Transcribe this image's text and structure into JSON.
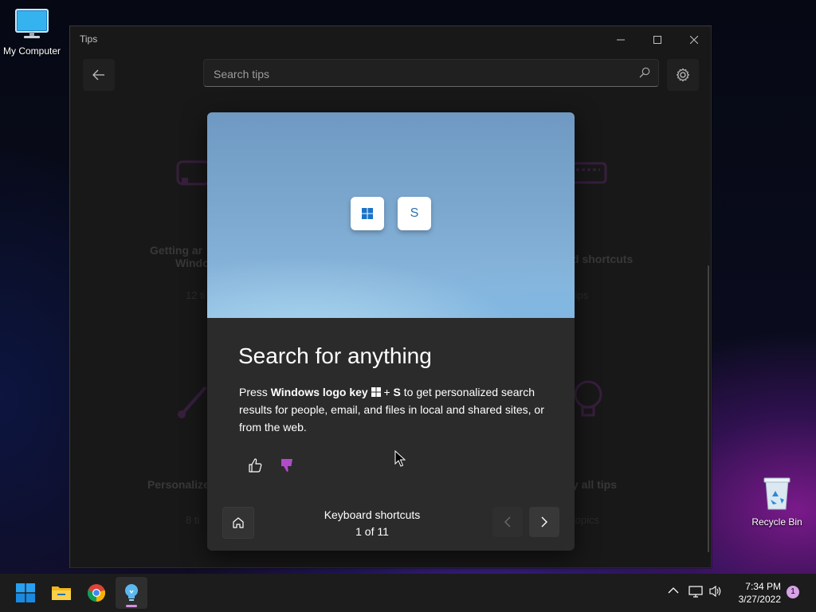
{
  "desktop": {
    "icons": [
      {
        "label": "My Computer"
      },
      {
        "label": "Recycle Bin"
      }
    ]
  },
  "window": {
    "title": "Tips",
    "search_placeholder": "Search tips"
  },
  "background_cards": [
    {
      "label": "Getting ar",
      "label2": "Windo",
      "sub": "12 ti"
    },
    {
      "label": "d shortcuts",
      "sub": "tips"
    },
    {
      "label": "Personalize",
      "sub": "8 ti"
    },
    {
      "label": "y all tips",
      "sub": "topics"
    }
  ],
  "dialog": {
    "title": "Search for anything",
    "body_press": "Press ",
    "body_key": "Windows logo key",
    "body_plus": " + ",
    "body_s": "S",
    "body_rest": " to get personalized search results for people, email, and files in local and shared sites, or from the web.",
    "key_s": "S",
    "category": "Keyboard shortcuts",
    "counter": "1 of 11"
  },
  "taskbar": {
    "apps": [
      "start",
      "file-explorer",
      "chrome",
      "tips"
    ],
    "time": "7:34 PM",
    "date": "3/27/2022",
    "notification_count": "1"
  }
}
